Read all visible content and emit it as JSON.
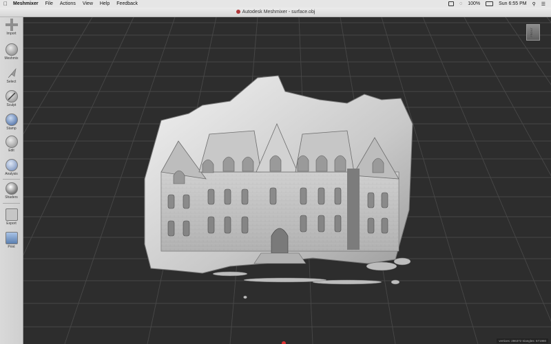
{
  "menubar": {
    "app": "Meshmixer",
    "items": [
      "File",
      "Actions",
      "View",
      "Help",
      "Feedback"
    ],
    "battery": "100%",
    "clock": "Sun 6:55 PM"
  },
  "window": {
    "title": "Autodesk Meshmixer - surface.obj"
  },
  "toolbar": {
    "items": [
      "Import",
      "Meshmix",
      "Select",
      "Sculpt",
      "Stamp",
      "Edit",
      "Analysis",
      "Shaders",
      "Export",
      "Print"
    ]
  },
  "viewport": {
    "status": "vertices: 286372 triangles: 571980",
    "viewcube_label": "FRONT",
    "colors": {
      "background": "#2d2d2d",
      "grid": "#4a4a4a",
      "mesh": "#d8d8d8"
    }
  },
  "icons": [
    "apple-icon",
    "airplay-icon",
    "wifi-icon",
    "battery-icon",
    "search-icon",
    "control-icon"
  ]
}
